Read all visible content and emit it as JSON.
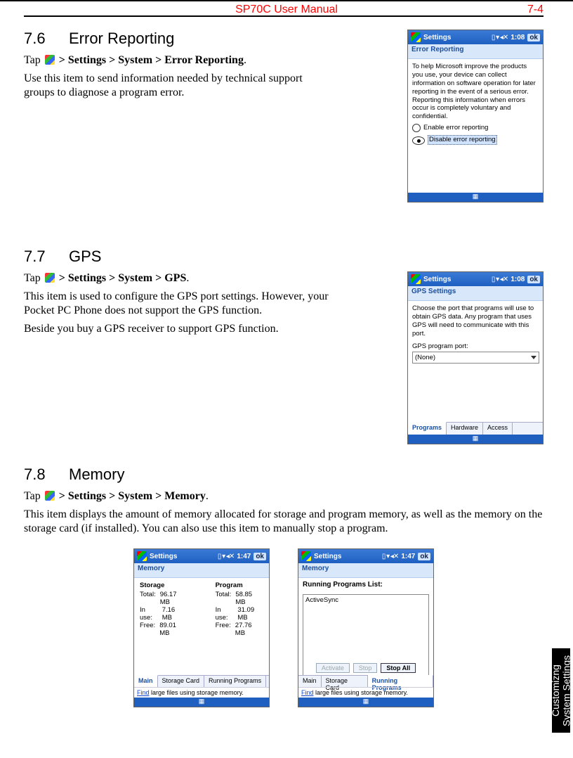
{
  "header": {
    "title": "SP70C User Manual",
    "page": "7-4"
  },
  "side_tab": "Customizng\nSystem Settings",
  "s76": {
    "heading_num": "7.6",
    "heading": "Error Reporting",
    "tap_prefix": "Tap ",
    "tap_path": " > Settings > System > Error Reporting",
    "body": "Use this item to send information needed by technical support groups to diagnose a program error.",
    "shot": {
      "title": "Settings",
      "time": "1:08",
      "ok": "ok",
      "sub": "Error Reporting",
      "text": "To help Microsoft improve the products you use, your device can collect information on software operation for later reporting in the event of a serious error. Reporting this information when errors occur is completely voluntary and confidential.",
      "opt1": "Enable error reporting",
      "opt2": "Disable error reporting"
    }
  },
  "s77": {
    "heading_num": "7.7",
    "heading": "GPS",
    "tap_prefix": "Tap ",
    "tap_path": " > Settings > System > GPS",
    "body1": "This item is used to configure the GPS port settings. However, your Pocket PC Phone does not support the GPS function.",
    "body2": "Beside you buy a GPS receiver to support GPS function.",
    "shot": {
      "title": "Settings",
      "time": "1:08",
      "ok": "ok",
      "sub": "GPS Settings",
      "text": "Choose the port that programs will use to obtain GPS data. Any program that uses GPS will need to communicate with this port.",
      "label": "GPS program port:",
      "value": "(None)",
      "tabs": [
        "Programs",
        "Hardware",
        "Access"
      ]
    }
  },
  "s78": {
    "heading_num": "7.8",
    "heading": "Memory",
    "tap_prefix": "Tap ",
    "tap_path": " > Settings > System > Memory",
    "body": "This item displays the amount of memory allocated for storage and program memory, as well as the memory on the storage card (if installed). You can also use this item to manually stop a program.",
    "shotA": {
      "title": "Settings",
      "time": "1:47",
      "ok": "ok",
      "sub": "Memory",
      "storage": {
        "h": "Storage",
        "total": "96.17 MB",
        "inuse": "7.16 MB",
        "free": "89.01 MB"
      },
      "program": {
        "h": "Program",
        "total": "58.85 MB",
        "inuse": "31.09 MB",
        "free": "27.76 MB"
      },
      "labels": {
        "total": "Total:",
        "inuse": "In use:",
        "free": "Free:"
      },
      "tabs": [
        "Main",
        "Storage Card",
        "Running Programs"
      ],
      "foot_link": "Find",
      "foot_rest": " large files using storage memory."
    },
    "shotB": {
      "title": "Settings",
      "time": "1:47",
      "ok": "ok",
      "sub": "Memory",
      "list_h": "Running Programs List:",
      "item": "ActiveSync",
      "btns": [
        "Activate",
        "Stop",
        "Stop All"
      ],
      "tabs": [
        "Main",
        "Storage Card",
        "Running Programs"
      ],
      "foot_link": "Find",
      "foot_rest": " large files using storage memory."
    }
  }
}
